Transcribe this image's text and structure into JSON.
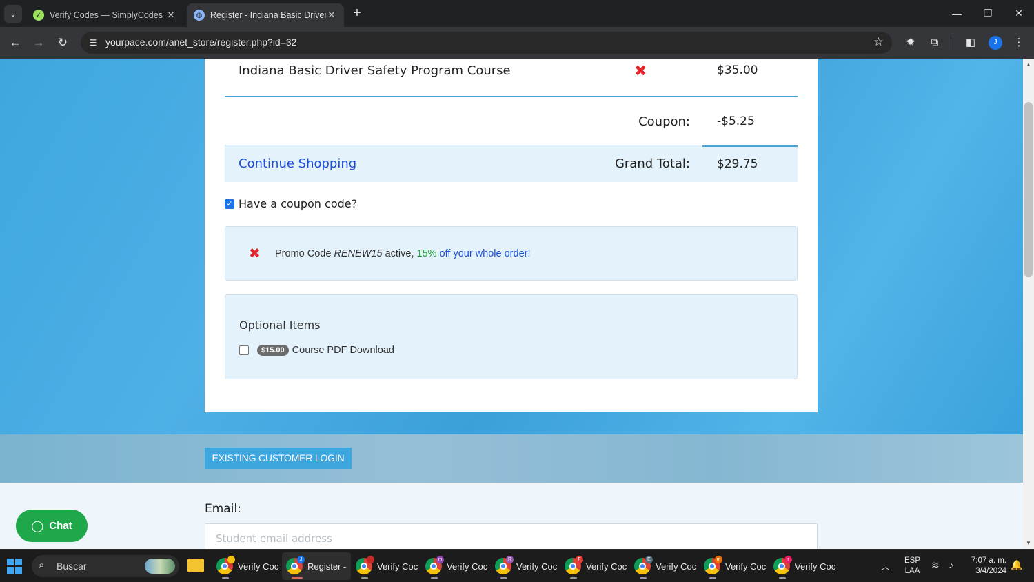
{
  "browser": {
    "tabs": [
      {
        "title": "Verify Codes — SimplyCodes",
        "active": false
      },
      {
        "title": "Register - Indiana Basic Driver S",
        "active": true
      }
    ],
    "new_tab_symbol": "+",
    "url": "yourpace.com/anet_store/register.php?id=32"
  },
  "cart": {
    "product_name": "Indiana Basic Driver Safety Program Course",
    "product_price": "$35.00",
    "coupon_label": "Coupon:",
    "coupon_value": "-$5.25",
    "continue_label": "Continue Shopping",
    "grand_total_label": "Grand Total:",
    "grand_total_value": "$29.75"
  },
  "coupon": {
    "checkbox_label": "Have a coupon code?",
    "checked": true,
    "promo_prefix": "Promo Code ",
    "promo_code": "RENEW15",
    "promo_middle": " active, ",
    "promo_percent": "15%",
    "promo_suffix": " off your whole order!"
  },
  "optional_items": {
    "title": "Optional Items",
    "items": [
      {
        "price": "$15.00",
        "label": "Course PDF Download",
        "checked": false
      }
    ]
  },
  "login": {
    "button_label": "EXISTING CUSTOMER LOGIN"
  },
  "form": {
    "email_label": "Email:",
    "email_placeholder": "Student email address"
  },
  "chat": {
    "label": "Chat"
  },
  "taskbar": {
    "search_label": "Buscar",
    "apps": [
      {
        "label": "Verify Coc",
        "badge": "",
        "badge_color": "#f4c20d"
      },
      {
        "label": "Register -",
        "badge": "J",
        "badge_color": "#1a73e8",
        "active": true
      },
      {
        "label": "Verify Coc",
        "badge": "",
        "badge_color": "#c62828"
      },
      {
        "label": "Verify Coc",
        "badge": "m",
        "badge_color": "#8e44ad"
      },
      {
        "label": "Verify Coc",
        "badge": "R",
        "badge_color": "#9b59b6"
      },
      {
        "label": "Verify Coc",
        "badge": "F",
        "badge_color": "#e53935"
      },
      {
        "label": "Verify Coc",
        "badge": "E",
        "badge_color": "#546e7a"
      },
      {
        "label": "Verify Coc",
        "badge": "m",
        "badge_color": "#ef6c00"
      },
      {
        "label": "Verify Coc",
        "badge": "r",
        "badge_color": "#e91e63"
      }
    ],
    "lang_top": "ESP",
    "lang_bottom": "LAA",
    "time": "7:07 a. m.",
    "date": "3/4/2024"
  },
  "profile_initial": "J",
  "colors": {
    "accent_blue": "#3ea6df",
    "link_blue": "#1d4fd8",
    "remove_red": "#e0262b",
    "promo_green": "#1e9d3a",
    "chat_green": "#1ea84a"
  }
}
